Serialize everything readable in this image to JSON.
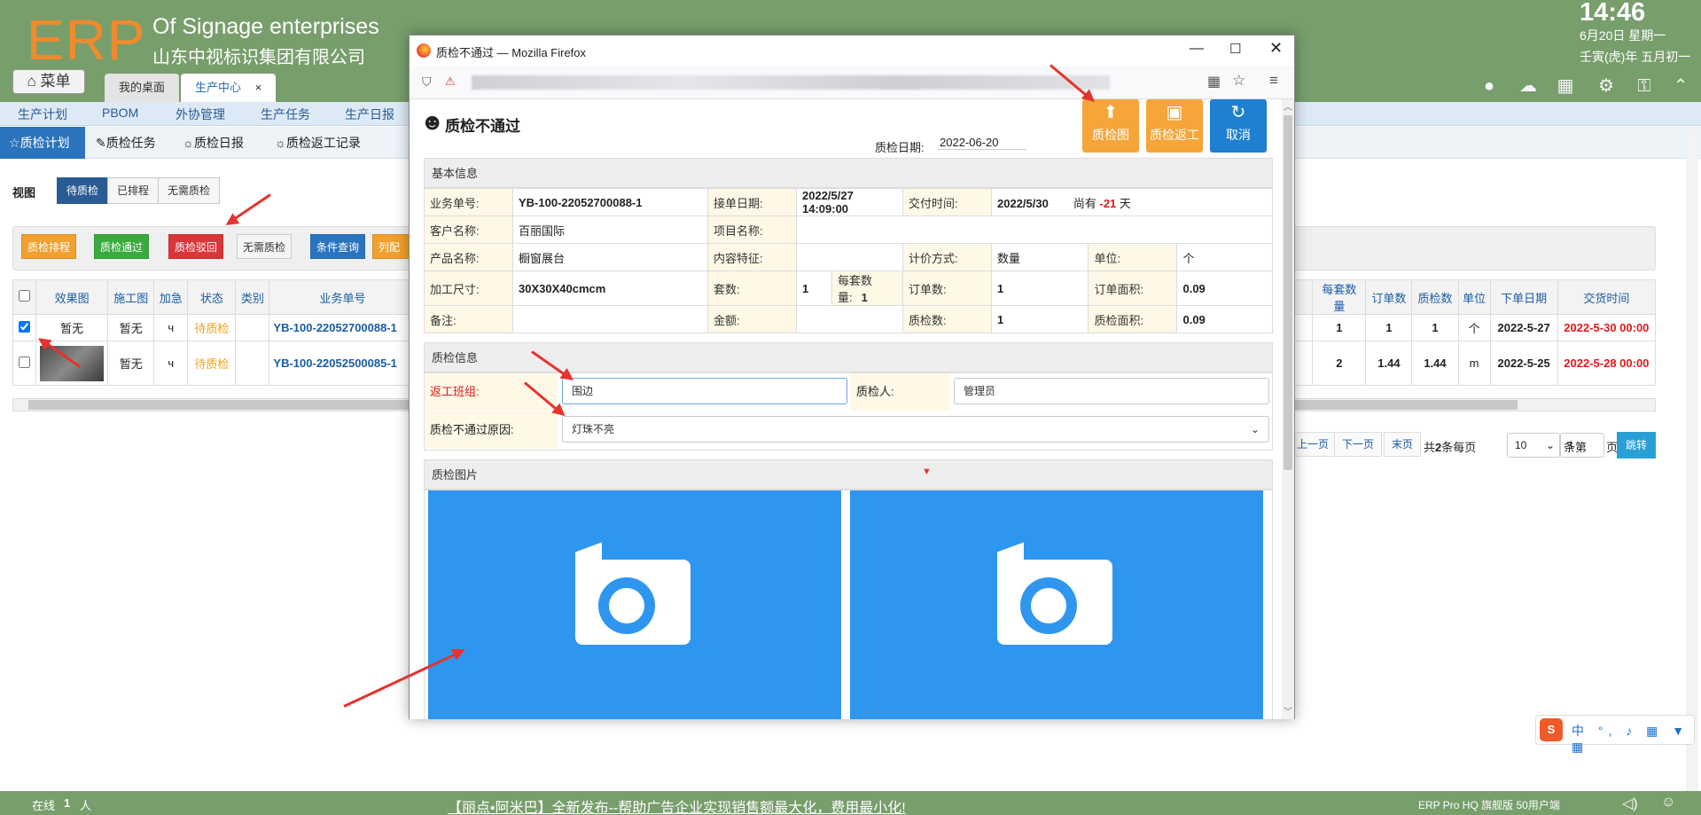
{
  "header": {
    "logo": "ERP",
    "subtitle_en": "Of Signage enterprises",
    "subtitle_cn": "山东中视标识集团有限公司",
    "time": "14:46",
    "date": "6月20日 星期一",
    "lunar": "壬寅(虎)年 五月初一"
  },
  "menu": {
    "label": "菜单"
  },
  "tabs": [
    {
      "label": "我的桌面"
    },
    {
      "label": "生产中心"
    }
  ],
  "tab_close": "×",
  "main_nav": [
    "生产计划",
    "PBOM",
    "外协管理",
    "生产任务",
    "生产日报"
  ],
  "sub_nav": [
    "质检计划",
    "质检任务",
    "质检日报",
    "质检返工记录"
  ],
  "view": {
    "label": "视图",
    "options": [
      "待质检",
      "已排程",
      "无需质检"
    ]
  },
  "toolbar": [
    "质检排程",
    "质检通过",
    "质检驳回",
    "无需质检",
    "条件查询",
    "列配置"
  ],
  "grid": {
    "headers_left": [
      "效果图",
      "施工图",
      "加急",
      "状态",
      "类别",
      "业务单号"
    ],
    "headers_right": [
      "每套数量",
      "订单数",
      "质检数",
      "单位",
      "下单日期",
      "交货时间"
    ],
    "rows": [
      {
        "effect": "暂无",
        "construct": "暂无",
        "urgent": "ч",
        "status": "待质检",
        "type": "",
        "order": "YB-100-22052700088-1",
        "per_set": "1",
        "qty": "1",
        "checked": "1",
        "unit": "个",
        "order_date": "2022-5-27",
        "delivery": "2022-5-30 00:00"
      },
      {
        "effect": "",
        "construct": "暂无",
        "urgent": "ч",
        "status": "待质检",
        "type": "",
        "order": "YB-100-22052500085-1",
        "per_set": "2",
        "qty": "1.44",
        "checked": "1.44",
        "unit": "m",
        "order_date": "2022-5-25",
        "delivery": "2022-5-28 00:00"
      }
    ]
  },
  "pager": {
    "prev": "上一页",
    "next": "下一页",
    "last": "末页",
    "total_prefix": "共",
    "total": "2",
    "total_mid": "条每页",
    "page_size": "10",
    "page_label_pre": "条第",
    "page": "1",
    "page_label_post": "页",
    "go": "跳转"
  },
  "bottom": {
    "online_label": "在线",
    "online_count": "1",
    "online_unit": "人",
    "ad": "【丽点•阿米巴】全新发布--帮助广告企业实现销售额最大化，费用最小化!",
    "version": "ERP Pro HQ 旗舰版 50用户端"
  },
  "dialog": {
    "window_title": "质检不通过 — Mozilla Firefox",
    "heading": "质检不通过",
    "date_label": "质检日期:",
    "date_value": "2022-06-20",
    "buttons": {
      "photo": "质检图",
      "rework": "质检返工",
      "cancel": "取消"
    },
    "basic_section": "基本信息",
    "basic": {
      "order_no_l": "业务单号:",
      "order_no": "YB-100-22052700088-1",
      "recv_l": "接单日期:",
      "recv": "2022/5/27 14:09:00",
      "deliv_l": "交付时间:",
      "deliv": "2022/5/30",
      "remain_pre": "尚有",
      "remain": "-21",
      "remain_post": "天",
      "cust_l": "客户名称:",
      "cust": "百丽国际",
      "proj_l": "项目名称:",
      "proj": "",
      "prod_l": "产品名称:",
      "prod": "橱窗展台",
      "content_l": "内容特征:",
      "content": "",
      "price_l": "计价方式:",
      "price": "数量",
      "unit_l": "单位:",
      "unit": "个",
      "size_l": "加工尺寸:",
      "size": "30X30X40cmcm",
      "sets_l": "套数:",
      "sets": "1",
      "perset_l": "每套数量:",
      "perset": "1",
      "qty_l": "订单数:",
      "qty": "1",
      "area_l": "订单面积:",
      "area": "0.09",
      "note_l": "备注:",
      "note": "",
      "amount_l": "金额:",
      "amount": "",
      "chk_l": "质检数:",
      "chk": "1",
      "chkarea_l": "质检面积:",
      "chkarea": "0.09"
    },
    "qc_section": "质检信息",
    "qc": {
      "team_l": "返工班组:",
      "team": "围边",
      "inspector_l": "质检人:",
      "inspector": "管理员",
      "reason_l": "质检不通过原因:",
      "reason": "灯珠不亮"
    },
    "photo_section": "质检图片"
  },
  "colors": {
    "header_bg": "#789e6c",
    "logo": "#f08a2c",
    "accent_blue": "#2a74bd",
    "photo_blue": "#2f96f0",
    "btn_orange": "#f5a53a",
    "btn_blue": "#1f7fd0",
    "arrow_red": "#e8322b"
  }
}
